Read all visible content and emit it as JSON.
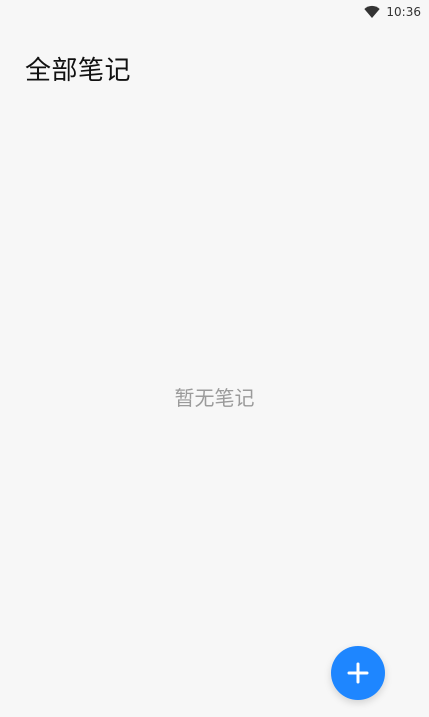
{
  "status_bar": {
    "time": "10:36",
    "wifi_icon": "wifi-icon"
  },
  "header": {
    "title": "全部笔记"
  },
  "main": {
    "empty_text": "暂无笔记"
  },
  "fab": {
    "icon": "plus-icon",
    "color": "#1e86ff"
  },
  "colors": {
    "background": "#f7f7f7",
    "title": "#111111",
    "empty_text": "#9b9b9b"
  }
}
